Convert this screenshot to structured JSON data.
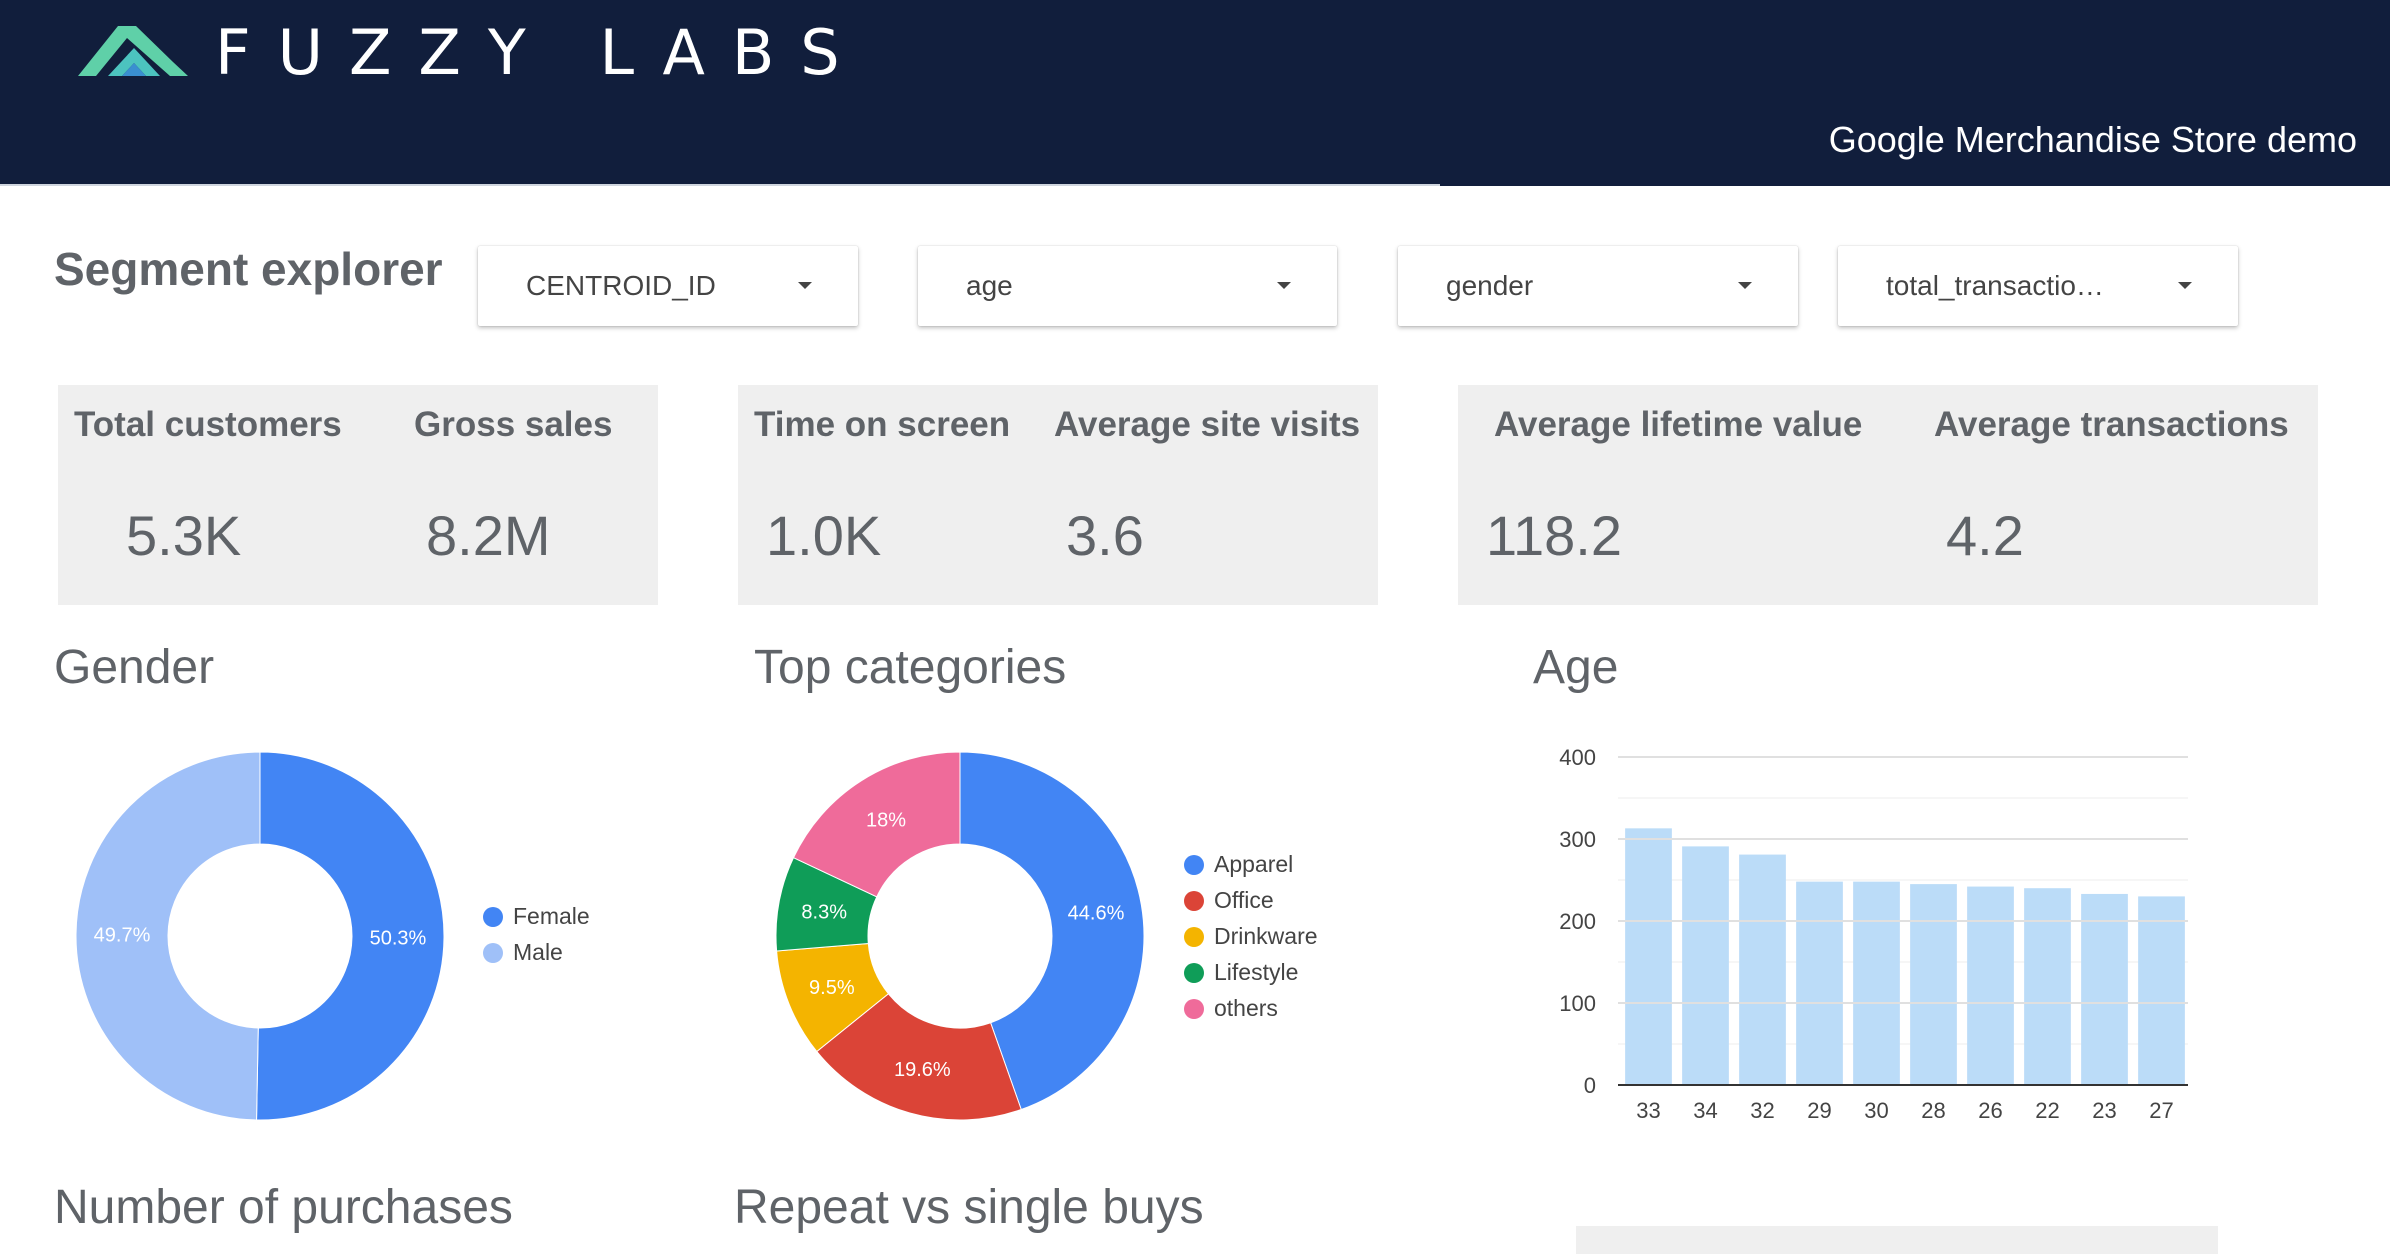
{
  "header": {
    "brand": "FUZZY LABS",
    "subtitle": "Google Merchandise Store demo",
    "logo_icon": "fuzzy-labs-logo-icon"
  },
  "controls": {
    "title": "Segment explorer",
    "dropdowns": [
      {
        "label": "CENTROID_ID"
      },
      {
        "label": "age"
      },
      {
        "label": "gender"
      },
      {
        "label": "total_transactio…"
      }
    ]
  },
  "kpis": {
    "total_customers": {
      "label": "Total customers",
      "value": "5.3K"
    },
    "gross_sales": {
      "label": "Gross sales",
      "value": "8.2M"
    },
    "time_on_screen": {
      "label": "Time on screen",
      "value": "1.0K"
    },
    "avg_site_visits": {
      "label": "Average site visits",
      "value": "3.6"
    },
    "avg_lifetime_value": {
      "label": "Average lifetime value",
      "value": "118.2"
    },
    "avg_transactions": {
      "label": "Average transactions",
      "value": "4.2"
    }
  },
  "sections": {
    "gender": "Gender",
    "top_categories": "Top categories",
    "age": "Age",
    "purchases": "Number of purchases",
    "repeat": "Repeat vs single buys"
  },
  "colors": {
    "header_bg": "#111e3c",
    "blue": "#4285f4",
    "light_blue": "#9fc0f8",
    "red": "#db4437",
    "yellow": "#f4b400",
    "green": "#0f9d58",
    "pink": "#ef6b9a",
    "bar": "#bbdcf8"
  },
  "chart_data": [
    {
      "type": "pie",
      "title": "Gender",
      "slices": [
        {
          "label": "Female",
          "value": 50.3,
          "display": "50.3%",
          "color": "#4285f4"
        },
        {
          "label": "Male",
          "value": 49.7,
          "display": "49.7%",
          "color": "#9fc0f8"
        }
      ],
      "legend": "right"
    },
    {
      "type": "pie",
      "title": "Top categories",
      "slices": [
        {
          "label": "Apparel",
          "value": 44.6,
          "display": "44.6%",
          "color": "#4285f4"
        },
        {
          "label": "Office",
          "value": 19.6,
          "display": "19.6%",
          "color": "#db4437"
        },
        {
          "label": "Drinkware",
          "value": 9.5,
          "display": "9.5%",
          "color": "#f4b400"
        },
        {
          "label": "Lifestyle",
          "value": 8.3,
          "display": "8.3%",
          "color": "#0f9d58"
        },
        {
          "label": "others",
          "value": 18.0,
          "display": "18%",
          "color": "#ef6b9a"
        }
      ],
      "legend": "right"
    },
    {
      "type": "bar",
      "title": "Age",
      "categories": [
        "33",
        "34",
        "32",
        "29",
        "30",
        "28",
        "26",
        "22",
        "23",
        "27"
      ],
      "values": [
        313,
        291,
        281,
        248,
        248,
        245,
        242,
        240,
        233,
        230
      ],
      "ylim": [
        0,
        400
      ],
      "yticks": [
        "0",
        "100",
        "200",
        "300",
        "400"
      ],
      "grid": true
    }
  ]
}
